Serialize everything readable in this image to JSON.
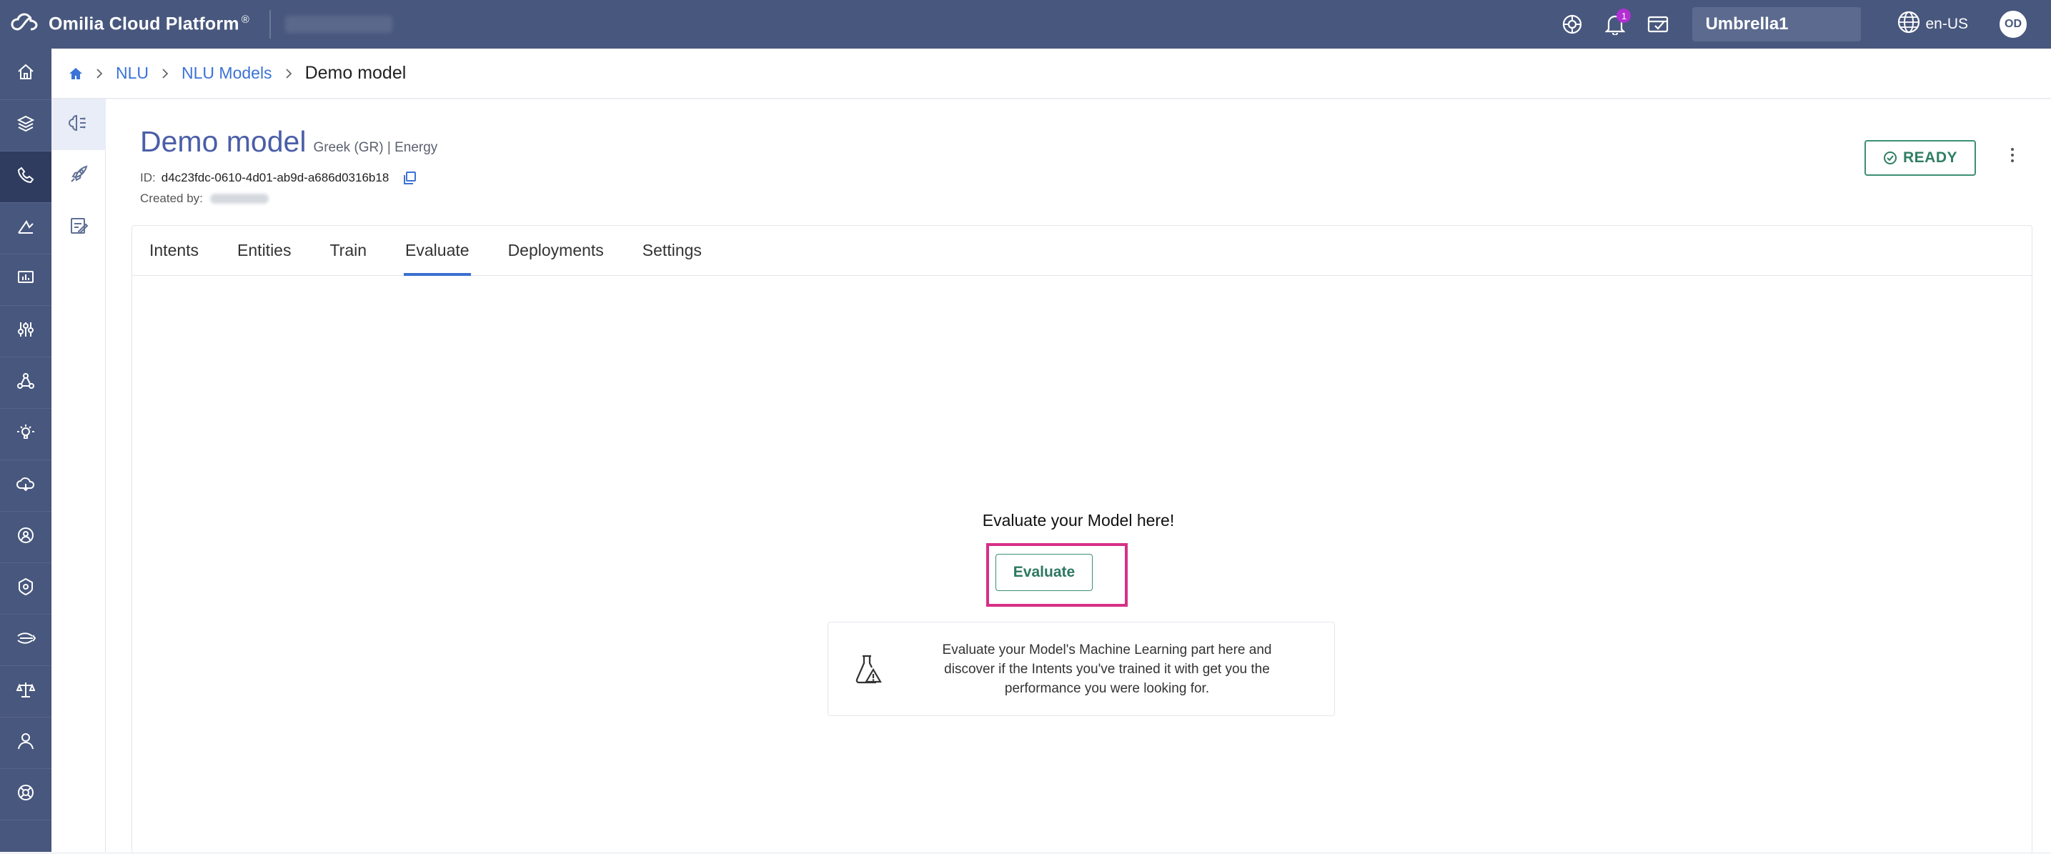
{
  "app": {
    "brand_name": "Omilia Cloud Platform",
    "brand_mark": "®",
    "notifications_count": "1",
    "tenant": "Umbrella1",
    "language": "en-US",
    "avatar_initials": "OD"
  },
  "left_nav": {
    "items": [
      {
        "icon": "home-icon"
      },
      {
        "icon": "layers-icon"
      },
      {
        "icon": "phone-icon"
      },
      {
        "icon": "analytics-icon"
      },
      {
        "icon": "presentation-icon"
      },
      {
        "icon": "sliders-icon"
      },
      {
        "icon": "network-icon"
      },
      {
        "icon": "bulb-icon"
      },
      {
        "icon": "cloud-icon"
      },
      {
        "icon": "settings-gear-icon"
      },
      {
        "icon": "shield-icon"
      },
      {
        "icon": "fish-icon"
      },
      {
        "icon": "scale-icon"
      },
      {
        "icon": "user-icon"
      },
      {
        "icon": "support-icon"
      }
    ],
    "active_index": 2
  },
  "breadcrumb": {
    "items": [
      "NLU",
      "NLU Models"
    ],
    "current": "Demo model"
  },
  "model": {
    "title": "Demo model",
    "subtitle": "Greek (GR) | Energy",
    "id_label": "ID:",
    "id_value": "d4c23fdc-0610-4d01-ab9d-a686d0316b18",
    "created_by_label": "Created by:",
    "status": "READY"
  },
  "tabs": {
    "items": [
      "Intents",
      "Entities",
      "Train",
      "Evaluate",
      "Deployments",
      "Settings"
    ],
    "active": "Evaluate"
  },
  "evaluate": {
    "heading": "Evaluate your Model here!",
    "button_label": "Evaluate",
    "info_line1": "Evaluate your Model's Machine Learning part here and",
    "info_line2": "discover if the Intents you've trained it with get you the",
    "info_line3": "performance you were looking for."
  },
  "colors": {
    "topbar": "#48577d",
    "accent_blue": "#3b73d6",
    "ready_green": "#3c8f73",
    "highlight_pink": "#d62f86"
  }
}
